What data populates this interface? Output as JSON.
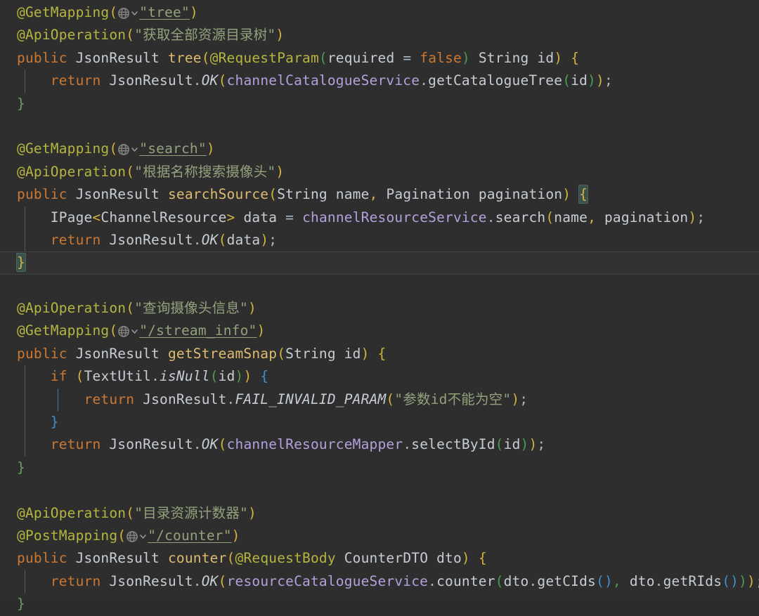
{
  "editor": {
    "language": "Java",
    "theme": "Darcula",
    "background_color": "#2e2e2e",
    "caret_line_color": "#323232",
    "brace_match_color": "#3b514d",
    "icons": {
      "globe": "globe-icon",
      "chevron": "chevron-down-icon"
    },
    "colors": {
      "annotation": "#b5b540",
      "keyword": "#cc7832",
      "type": "#c7cdd4",
      "method": "#ddbb6f",
      "field": "#b3a0dd",
      "string": "#93a27c",
      "paren_level0": "#d4b23f",
      "paren_level1": "#4f9b51",
      "paren_level2": "#3f8fd0",
      "brace_green": "#6a9f62",
      "brace_blue": "#3f8fd0"
    }
  },
  "code": {
    "block1": {
      "mapping_annotation": "@GetMapping",
      "mapping_path": "\"tree\"",
      "api_annotation": "@ApiOperation",
      "api_desc": "\"获取全部资源目录树\"",
      "modifier": "public",
      "return_type": "JsonResult",
      "method_name": "tree",
      "param_annotation": "@RequestParam",
      "param_attr": "required",
      "param_attr_value": "false",
      "param_type": "String",
      "param_name": "id",
      "body_keyword": "return",
      "body_class": "JsonResult",
      "body_static": "OK",
      "body_field": "channelCatalogueService",
      "body_call": "getCatalogueTree",
      "body_arg": "id"
    },
    "block2": {
      "mapping_annotation": "@GetMapping",
      "mapping_path": "\"search\"",
      "api_annotation": "@ApiOperation",
      "api_desc": "\"根据名称搜索摄像头\"",
      "modifier": "public",
      "return_type": "JsonResult",
      "method_name": "searchSource",
      "param1_type": "String",
      "param1_name": "name",
      "param2_type": "Pagination",
      "param2_name": "pagination",
      "var_type": "IPage",
      "var_generic": "ChannelResource",
      "var_name": "data",
      "var_field": "channelResourceService",
      "var_call": "search",
      "var_arg1": "name",
      "var_arg2": "pagination",
      "body_keyword": "return",
      "body_class": "JsonResult",
      "body_static": "OK",
      "body_arg": "data"
    },
    "block3": {
      "api_annotation": "@ApiOperation",
      "api_desc": "\"查询摄像头信息\"",
      "mapping_annotation": "@GetMapping",
      "mapping_path": "\"/stream_info\"",
      "modifier": "public",
      "return_type": "JsonResult",
      "method_name": "getStreamSnap",
      "param_type": "String",
      "param_name": "id",
      "if_keyword": "if",
      "if_class": "TextUtil",
      "if_static": "isNull",
      "if_arg": "id",
      "fail_keyword": "return",
      "fail_class": "JsonResult",
      "fail_static": "FAIL_INVALID_PARAM",
      "fail_msg": "\"参数id不能为空\"",
      "body_keyword": "return",
      "body_class": "JsonResult",
      "body_static": "OK",
      "body_field": "channelResourceMapper",
      "body_call": "selectById",
      "body_arg": "id"
    },
    "block4": {
      "api_annotation": "@ApiOperation",
      "api_desc": "\"目录资源计数器\"",
      "mapping_annotation": "@PostMapping",
      "mapping_path": "\"/counter\"",
      "modifier": "public",
      "return_type": "JsonResult",
      "method_name": "counter",
      "param_annotation": "@RequestBody",
      "param_type": "CounterDTO",
      "param_name": "dto",
      "body_keyword": "return",
      "body_class": "JsonResult",
      "body_static": "OK",
      "body_field": "resourceCatalogueService",
      "body_call": "counter",
      "body_arg1_obj": "dto",
      "body_arg1_call": "getCIds",
      "body_arg2_obj": "dto",
      "body_arg2_call": "getRIds"
    },
    "symbols": {
      "lparen": "(",
      "rparen": ")",
      "lbrace": "{",
      "rbrace": "}",
      "semicolon": ";",
      "comma": ",",
      "dot": ".",
      "equals": "=",
      "lt": "<",
      "gt": ">"
    }
  }
}
